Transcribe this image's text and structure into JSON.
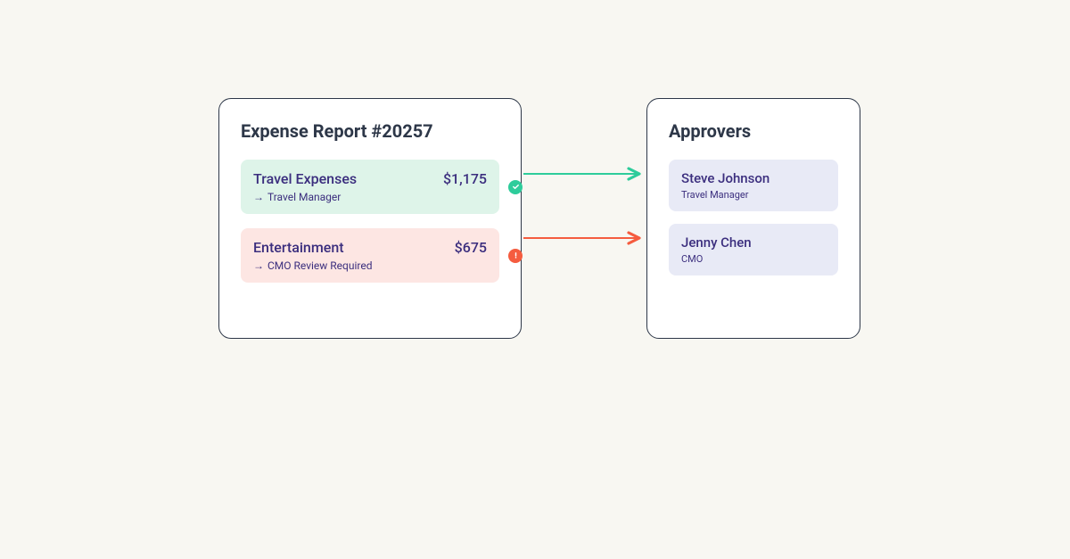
{
  "expense_card": {
    "title": "Expense Report #20257",
    "items": [
      {
        "name": "Travel Expenses",
        "amount": "$1,175",
        "subtext": "Travel Manager",
        "status": "approved"
      },
      {
        "name": "Entertainment",
        "amount": "$675",
        "subtext": "CMO Review Required",
        "status": "alert"
      }
    ]
  },
  "approvers_card": {
    "title": "Approvers",
    "items": [
      {
        "name": "Steve Johnson",
        "role": "Travel Manager"
      },
      {
        "name": "Jenny Chen",
        "role": "CMO"
      }
    ]
  },
  "colors": {
    "green": "#2ecc9b",
    "red": "#f55c3f"
  }
}
